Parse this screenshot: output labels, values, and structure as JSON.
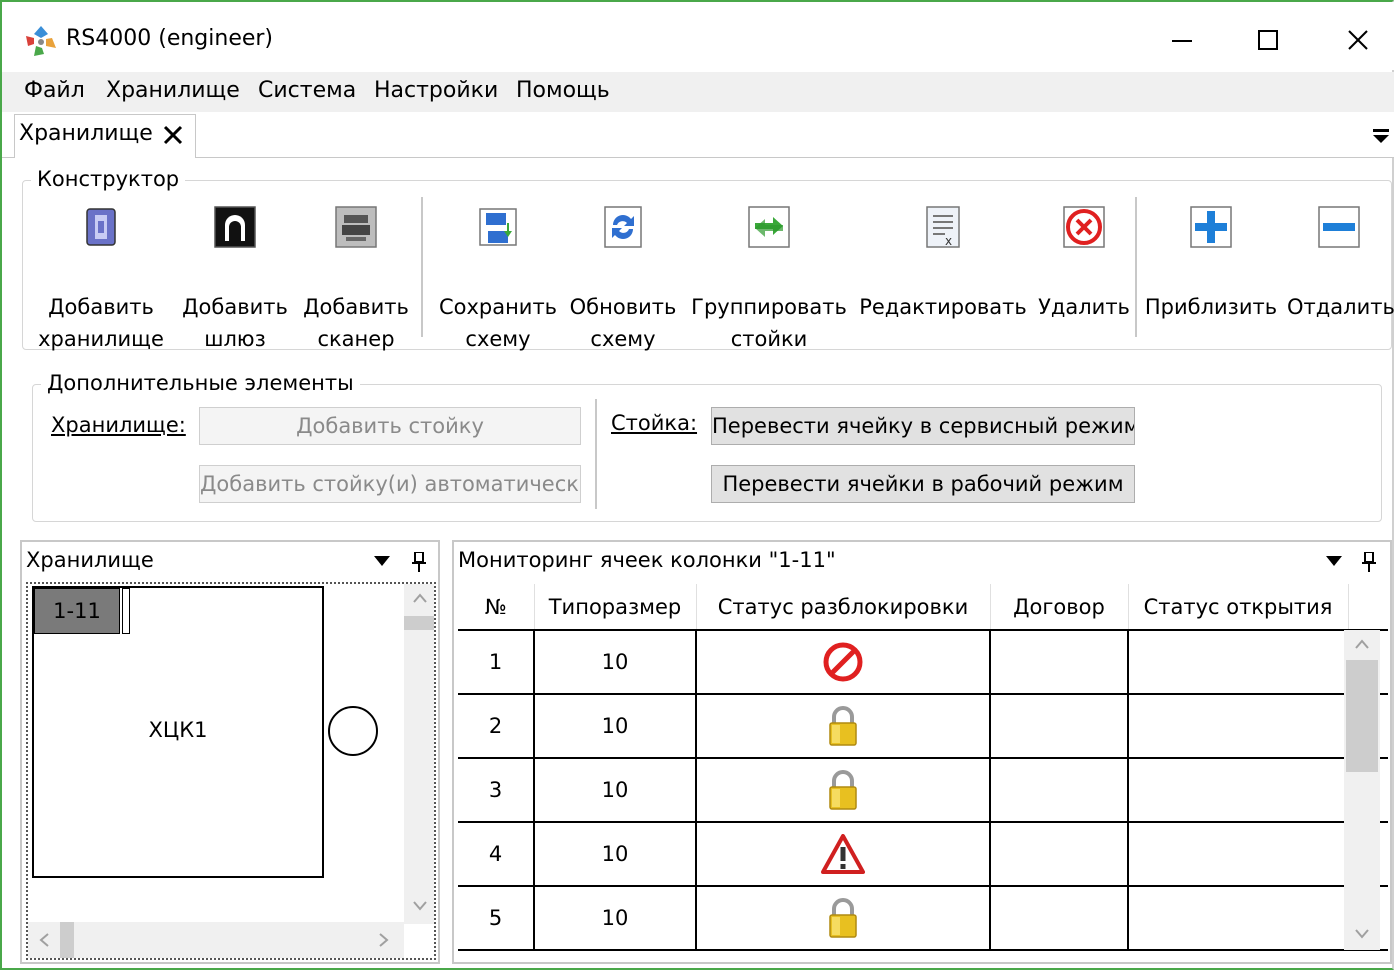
{
  "window": {
    "title": "RS4000 (engineer)"
  },
  "menu": [
    "Файл",
    "Хранилище",
    "Система",
    "Настройки",
    "Помощь"
  ],
  "doc_tab": {
    "label": "Хранилище"
  },
  "constructor": {
    "title": "Конструктор",
    "buttons": [
      {
        "id": "add-storage",
        "label": "Добавить\nхранилище",
        "icon": "storage-icon"
      },
      {
        "id": "add-gateway",
        "label": "Добавить\nшлюз",
        "icon": "gateway-icon"
      },
      {
        "id": "add-scanner",
        "label": "Добавить\nсканер",
        "icon": "scanner-icon"
      },
      {
        "id": "save-schema",
        "label": "Сохранить\nсхему",
        "icon": "save-icon"
      },
      {
        "id": "refresh-schema",
        "label": "Обновить\nсхему",
        "icon": "refresh-icon"
      },
      {
        "id": "group-racks",
        "label": "Группировать\nстойки",
        "icon": "group-icon"
      },
      {
        "id": "edit",
        "label": "Редактировать",
        "icon": "edit-icon"
      },
      {
        "id": "delete",
        "label": "Удалить",
        "icon": "delete-icon"
      },
      {
        "id": "zoom-in",
        "label": "Приблизить",
        "icon": "zoom-in-icon"
      },
      {
        "id": "zoom-out",
        "label": "Отдалить",
        "icon": "zoom-out-icon"
      }
    ]
  },
  "extras": {
    "title": "Дополнительные элементы",
    "storage_label": "Хранилище:",
    "add_rack": "Добавить стойку",
    "add_rack_auto": "Добавить стойку(и) автоматически",
    "rack_label": "Стойка:",
    "cell_service": "Перевести ячейку в сервисный режим",
    "cells_work": "Перевести ячейки в рабочий режим"
  },
  "storage_panel": {
    "title": "Хранилище",
    "column_tag": "1-11",
    "column_label": "ХЦК1"
  },
  "monitor_panel": {
    "title": "Мониторинг ячеек колонки \"1-11\"",
    "columns": [
      "№",
      "Типоразмер",
      "Статус разблокировки",
      "Договор",
      "Статус открытия"
    ],
    "rows": [
      {
        "n": "1",
        "size": "10",
        "status": "blocked-icon",
        "contract": "",
        "open": ""
      },
      {
        "n": "2",
        "size": "10",
        "status": "lock-icon",
        "contract": "",
        "open": ""
      },
      {
        "n": "3",
        "size": "10",
        "status": "lock-icon",
        "contract": "",
        "open": ""
      },
      {
        "n": "4",
        "size": "10",
        "status": "warning-icon",
        "contract": "",
        "open": ""
      },
      {
        "n": "5",
        "size": "10",
        "status": "lock-icon",
        "contract": "",
        "open": ""
      }
    ]
  }
}
